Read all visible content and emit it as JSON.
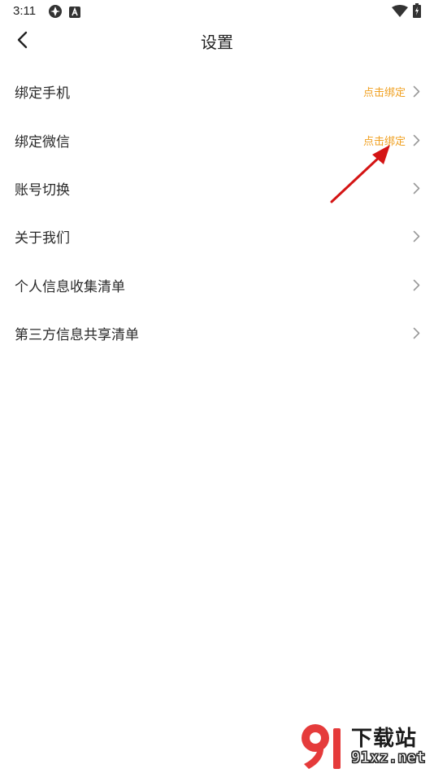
{
  "status_bar": {
    "time": "3:11",
    "icons": [
      "app-notification-icon",
      "a-badge-icon",
      "wifi-icon",
      "battery-charging-icon"
    ]
  },
  "header": {
    "title": "设置",
    "back_icon": "chevron-left-icon"
  },
  "menu": {
    "items": [
      {
        "label": "绑定手机",
        "action": "点击绑定"
      },
      {
        "label": "绑定微信",
        "action": "点击绑定"
      },
      {
        "label": "账号切换",
        "action": ""
      },
      {
        "label": "关于我们",
        "action": ""
      },
      {
        "label": "个人信息收集清单",
        "action": ""
      },
      {
        "label": "第三方信息共享清单",
        "action": ""
      }
    ],
    "chevron_icon": "chevron-right-icon"
  },
  "colors": {
    "action_text": "#f0a020",
    "annotation_arrow": "#d41414",
    "watermark_red": "#e53b3b"
  },
  "watermark": {
    "top_text": "下载站",
    "bottom_text": "91xz.net",
    "logo_text": "9"
  }
}
